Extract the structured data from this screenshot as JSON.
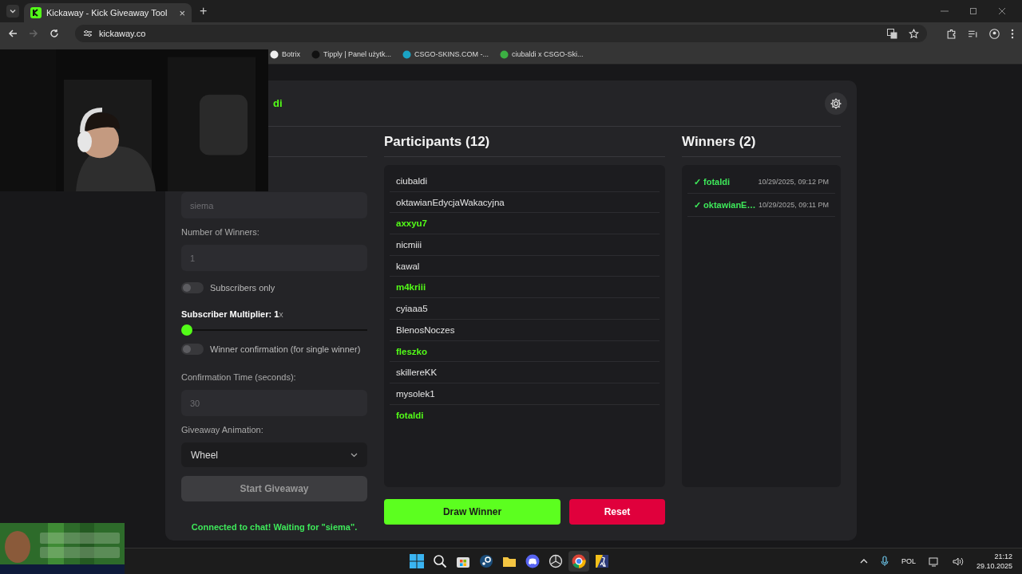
{
  "browser": {
    "tab": {
      "title": "Kickaway - Kick Giveaway Tool",
      "close": "×"
    },
    "new_tab": "+",
    "address": "kickaway.co",
    "bookmarks": [
      {
        "label": "Botrix"
      },
      {
        "label": "Tipply | Panel użytk..."
      },
      {
        "label": "CSGO-SKINS.COM -..."
      },
      {
        "label": "ciubaldi x CSGO-Ski..."
      }
    ]
  },
  "header": {
    "title": "di"
  },
  "form": [
    {
      "kind": "input",
      "placeholder": "siema"
    },
    {
      "kind": "label",
      "text": "Number of Winners:"
    },
    {
      "kind": "input",
      "placeholder": "1"
    },
    {
      "kind": "toggle",
      "label": "Subscribers only",
      "on": false
    },
    {
      "kind": "heading",
      "text": "**Subscriber Multiplier: 1**x"
    },
    {
      "kind": "slider",
      "level": 0
    },
    {
      "kind": "toggle",
      "label": "Winner confirmation (for single winner)",
      "on": false
    },
    {
      "kind": "label",
      "text": "Confirmation Time (seconds):"
    },
    {
      "kind": "input",
      "placeholder": "30"
    },
    {
      "kind": "label",
      "text": "Giveaway Animation:"
    },
    {
      "kind": "select",
      "value": "Wheel"
    },
    {
      "kind": "button",
      "label": "Start Giveaway",
      "disabled": true
    }
  ],
  "status": "Connected to chat! Waiting for \"siema\".",
  "participants": {
    "title": "Participants (12)",
    "items": [
      {
        "name": "ciubaldi",
        "highlighted": false
      },
      {
        "name": "oktawianEdycjaWakacyjna",
        "highlighted": false
      },
      {
        "name": "axxyu7",
        "highlighted": true
      },
      {
        "name": "nicmiii",
        "highlighted": false
      },
      {
        "name": "kawal",
        "highlighted": false
      },
      {
        "name": "m4kriii",
        "highlighted": true
      },
      {
        "name": "cyiaaa5",
        "highlighted": false
      },
      {
        "name": "BlenosNoczes",
        "highlighted": false
      },
      {
        "name": "fleszko",
        "highlighted": true
      },
      {
        "name": "skillereKK",
        "highlighted": false
      },
      {
        "name": "mysolek1",
        "highlighted": false
      },
      {
        "name": "fotaldi",
        "highlighted": true
      }
    ]
  },
  "actions": [
    {
      "kind": "draw",
      "label": "Draw Winner"
    },
    {
      "kind": "reset",
      "label": "Reset"
    }
  ],
  "winners": {
    "title": "Winners (2)",
    "items": [
      {
        "name": "✓ fotaldi",
        "time": "10/29/2025, 09:12 PM"
      },
      {
        "name": "✓ oktawianE…",
        "time": "10/29/2025, 09:11 PM"
      }
    ]
  },
  "taskbar": {
    "language": "POL",
    "time": "21:12",
    "date": "29.10.2025"
  }
}
